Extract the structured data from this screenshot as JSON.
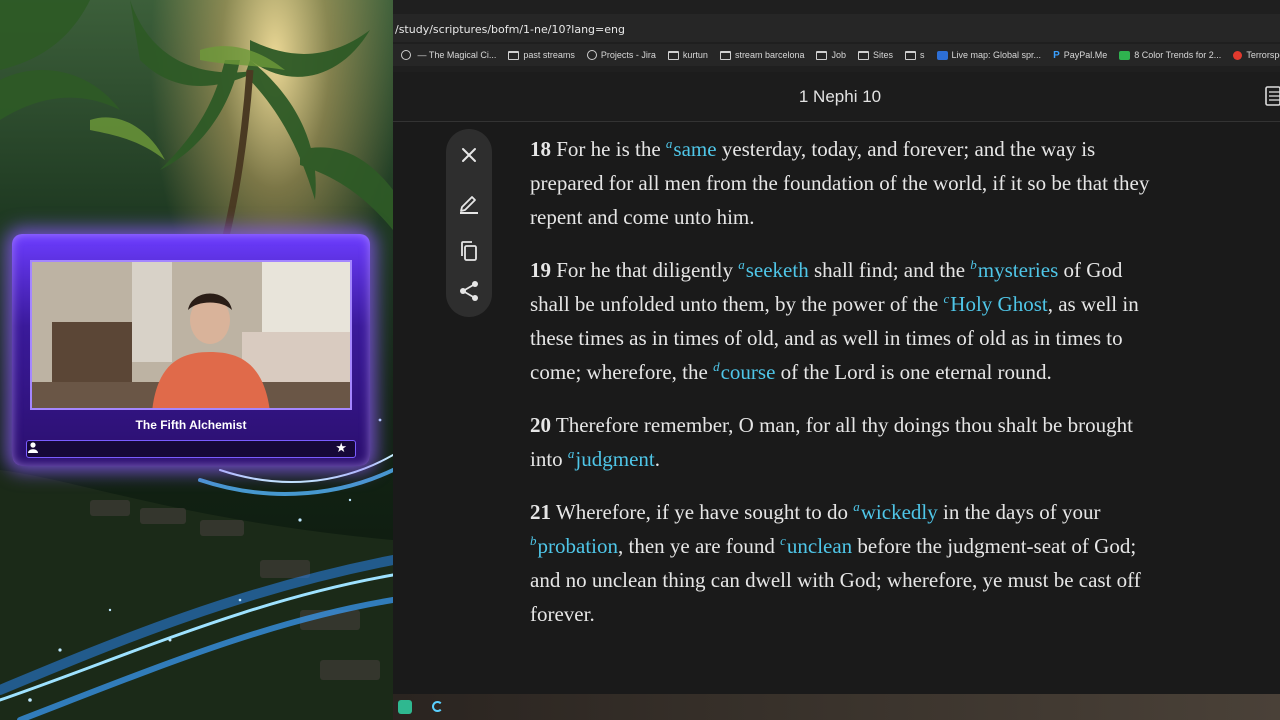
{
  "stream": {
    "streamer_name": "The Fifth Alchemist"
  },
  "browser": {
    "url": "/study/scriptures/bofm/1-ne/10?lang=eng",
    "bookmarks": [
      {
        "icon": "circle-icon",
        "label": " — The Magical Ci..."
      },
      {
        "icon": "folder-icon",
        "label": "past streams"
      },
      {
        "icon": "globe-icon",
        "label": "Projects - Jira"
      },
      {
        "icon": "folder-icon",
        "label": "kurtun"
      },
      {
        "icon": "folder-icon",
        "label": "stream barcelona"
      },
      {
        "icon": "folder-icon",
        "label": "Job"
      },
      {
        "icon": "folder-icon",
        "label": "Sites"
      },
      {
        "icon": "folder-icon",
        "label": "s"
      },
      {
        "icon": "map-icon",
        "label": "Live map: Global spr..."
      },
      {
        "icon": "paypal-icon",
        "label": "PayPal.Me"
      },
      {
        "icon": "green-app-icon",
        "label": "8 Color Trends for 2..."
      },
      {
        "icon": "youtube-icon",
        "label": "Terrorsperg | A Mist..."
      }
    ]
  },
  "page": {
    "chapter_title": "1 Nephi 10"
  },
  "verses": [
    {
      "number": "18",
      "parts": [
        {
          "t": " For he is the "
        },
        {
          "sup": "a",
          "link": "same"
        },
        {
          "t": " yesterday, today, and forever; and the way is prepared for all men from the foundation of the world, if it so be that they repent and come unto him."
        }
      ]
    },
    {
      "number": "19",
      "parts": [
        {
          "t": " For he that diligently "
        },
        {
          "sup": "a",
          "link": "seeketh"
        },
        {
          "t": " shall find; and the "
        },
        {
          "sup": "b",
          "link": "mysteries"
        },
        {
          "t": " of God shall be unfolded unto them, by the power of the "
        },
        {
          "sup": "c",
          "link": "Holy Ghost"
        },
        {
          "t": ", as well in these times as in times of old, and as well in times of old as in times to come; wherefore, the "
        },
        {
          "sup": "d",
          "link": "course"
        },
        {
          "t": " of the Lord is one eternal round."
        }
      ]
    },
    {
      "number": "20",
      "parts": [
        {
          "t": " Therefore remember, O man, for all thy doings thou shalt be brought into "
        },
        {
          "sup": "a",
          "link": "judgment"
        },
        {
          "t": "."
        }
      ]
    },
    {
      "number": "21",
      "parts": [
        {
          "t": " Wherefore, if ye have sought to do "
        },
        {
          "sup": "a",
          "link": "wickedly"
        },
        {
          "t": " in the days of your "
        },
        {
          "sup": "b",
          "link": "probation"
        },
        {
          "t": ", then ye are found "
        },
        {
          "sup": "c",
          "link": "unclean"
        },
        {
          "t": " before the judgment-seat of God; and no unclean thing can dwell with God; wherefore, ye must be cast off forever."
        }
      ]
    }
  ],
  "colors": {
    "link": "#4fc6e8",
    "text": "#e6e6e6",
    "frame_accent": "#6c3cff"
  }
}
